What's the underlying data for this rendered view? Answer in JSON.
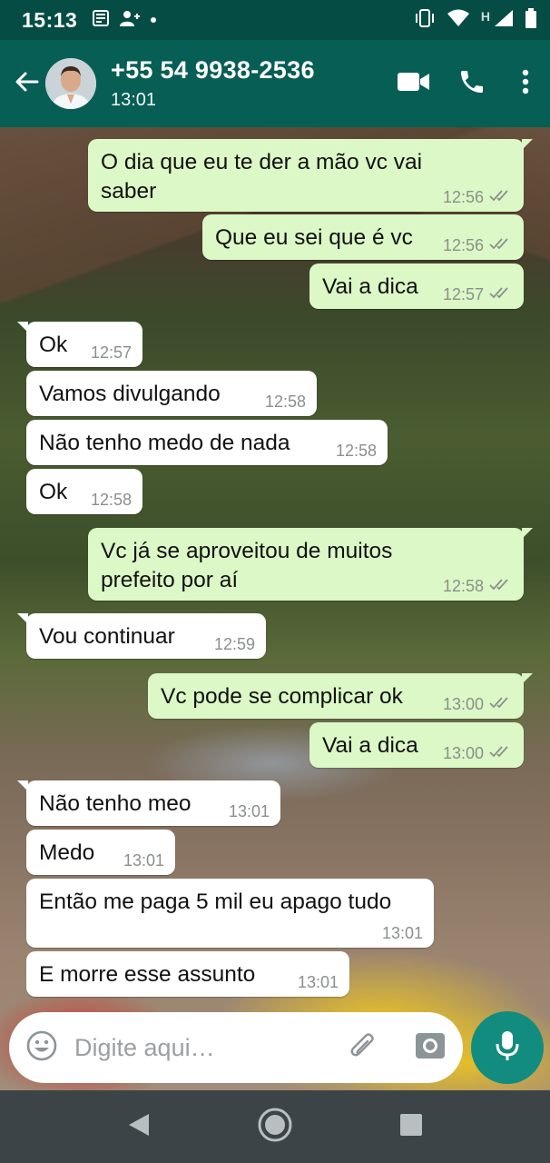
{
  "status_bar": {
    "time": "15:13",
    "network_label": "H"
  },
  "header": {
    "contact_name": "+55 54 9938-2536",
    "last_seen": "13:01"
  },
  "messages": [
    {
      "direction": "out",
      "text": "O dia que eu te der a mão vc vai\nsaber",
      "time": "12:56",
      "read": true
    },
    {
      "direction": "out",
      "text": "Que eu sei que é vc",
      "time": "12:56",
      "read": true
    },
    {
      "direction": "out",
      "text": "Vai a dica",
      "time": "12:57",
      "read": true
    },
    {
      "direction": "in",
      "text": "Ok",
      "time": "12:57"
    },
    {
      "direction": "in",
      "text": "Vamos divulgando",
      "time": "12:58"
    },
    {
      "direction": "in",
      "text": "Não tenho medo de nada",
      "time": "12:58"
    },
    {
      "direction": "in",
      "text": "Ok",
      "time": "12:58"
    },
    {
      "direction": "out",
      "text": "Vc já se aproveitou de muitos\nprefeito por aí",
      "time": "12:58",
      "read": true
    },
    {
      "direction": "in",
      "text": "Vou continuar",
      "time": "12:59"
    },
    {
      "direction": "out",
      "text": "Vc pode se complicar ok",
      "time": "13:00",
      "read": true
    },
    {
      "direction": "out",
      "text": "Vai a dica",
      "time": "13:00",
      "read": true
    },
    {
      "direction": "in",
      "text": "Não tenho meo",
      "time": "13:01"
    },
    {
      "direction": "in",
      "text": "Medo",
      "time": "13:01"
    },
    {
      "direction": "in",
      "text": "Então me paga 5 mil eu apago tudo",
      "time": "13:01"
    },
    {
      "direction": "in",
      "text": "E morre esse assunto",
      "time": "13:01"
    }
  ],
  "composer": {
    "placeholder": "Digite aqui…"
  },
  "icons": {
    "back": "arrow-left-icon",
    "video": "video-camera-icon",
    "call": "phone-icon",
    "menu": "more-vertical-icon",
    "emoji": "emoji-icon",
    "attach": "paperclip-icon",
    "camera": "camera-icon",
    "mic": "microphone-icon",
    "read_receipt": "double-check-icon"
  },
  "colors": {
    "header": "#075e54",
    "status_bar": "#054d44",
    "outgoing_bubble": "#dcf8c6",
    "incoming_bubble": "#ffffff",
    "mic_button": "#128c7e"
  }
}
